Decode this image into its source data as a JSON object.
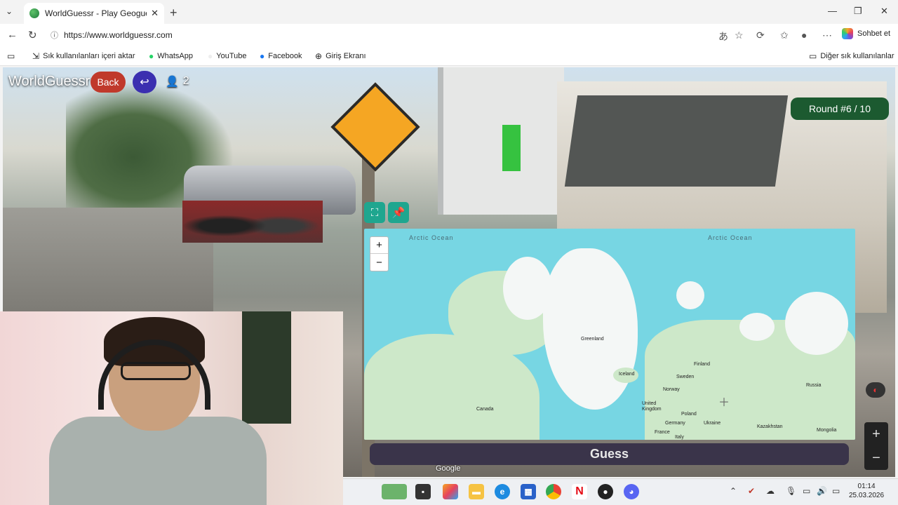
{
  "browser": {
    "tab_title": "WorldGuessr - Play Geoguessr for",
    "url": "https://www.worldguessr.com",
    "copilot_label": "Sohbet et",
    "bookmarks": [
      "Sık kullanılanları içeri aktar",
      "WhatsApp",
      "YouTube",
      "Facebook",
      "Giriş Ekranı"
    ],
    "other_bookmarks": "Diğer sık kullanılanlar"
  },
  "game": {
    "logo": "WorldGuessr",
    "back_label": "Back",
    "player_count": "2",
    "round_label": "Round #6 / 10",
    "guess_label": "Guess",
    "google_label": "Google"
  },
  "map": {
    "zoom_in": "+",
    "zoom_out": "−",
    "ocean_labels": [
      "Arctic Ocean",
      "Arctic Ocean"
    ],
    "place_labels": {
      "greenland": "Greenland",
      "iceland": "Iceland",
      "canada": "Canada",
      "finland": "Finland",
      "sweden": "Sweden",
      "norway": "Norway",
      "russia": "Russia",
      "uk": "United Kingdom",
      "poland": "Poland",
      "ukraine": "Ukraine",
      "germany": "Germany",
      "france": "France",
      "italy": "Italy",
      "kazakhstan": "Kazakhstan",
      "mongolia": "Mongolia"
    }
  },
  "streetview": {
    "zoom_in": "+",
    "zoom_out": "−"
  },
  "taskbar": {
    "time": "01:14",
    "date": "25.03.2026"
  },
  "colors": {
    "back_button": "#c0392b",
    "round_badge": "#1c5a30",
    "map_ocean": "#77d6e3",
    "guess_button": "#3a344a"
  }
}
